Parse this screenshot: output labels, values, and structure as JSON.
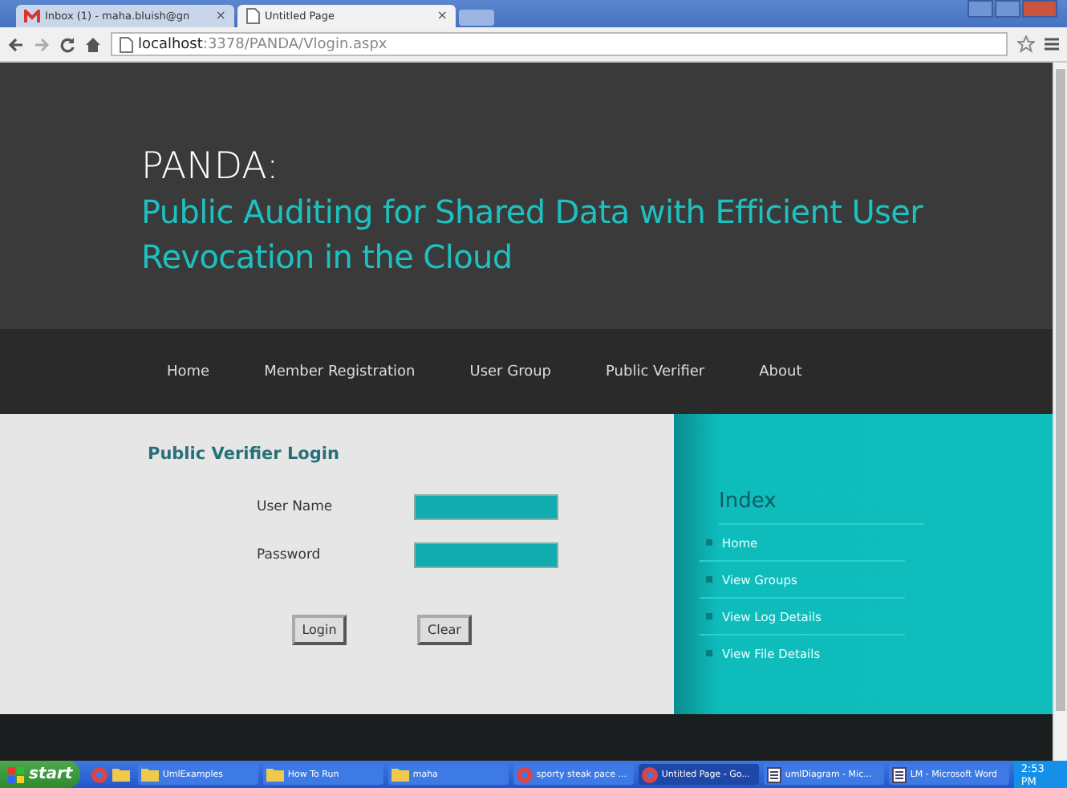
{
  "browser": {
    "tabs": [
      {
        "title": "Inbox (1) - maha.bluish@gn",
        "kind": "mail",
        "close": "×",
        "selected": false
      },
      {
        "title": "Untitled Page",
        "kind": "page",
        "close": "×",
        "selected": true
      }
    ],
    "address": {
      "host": "localhost",
      "rest": ":3378/PANDA/Vlogin.aspx"
    }
  },
  "header": {
    "logo": "PANDA:",
    "subtitle": "Public Auditing for Shared Data with Efficient User Revocation in the Cloud"
  },
  "nav": [
    "Home",
    "Member Registration",
    "User Group",
    "Public Verifier",
    "About"
  ],
  "login": {
    "title": "Public Verifier Login",
    "fields": [
      {
        "label": "User Name"
      },
      {
        "label": "Password"
      }
    ],
    "buttons": [
      "Login",
      "Clear"
    ]
  },
  "sidebar": {
    "title": "Index",
    "items": [
      "Home",
      "View Groups",
      "View Log Details",
      "View File Details"
    ]
  },
  "taskbar": {
    "start": "start",
    "items": [
      {
        "label": "UmlExamples",
        "kind": "folder",
        "selected": false
      },
      {
        "label": "How To Run",
        "kind": "folder",
        "selected": false
      },
      {
        "label": "maha",
        "kind": "folder",
        "selected": false
      },
      {
        "label": "sporty steak pace ...",
        "kind": "browser",
        "selected": false
      },
      {
        "label": "Untitled Page - Go...",
        "kind": "browser",
        "selected": true
      },
      {
        "label": "umlDiagram - Mic...",
        "kind": "doc",
        "selected": false
      },
      {
        "label": "LM - Microsoft Word",
        "kind": "doc",
        "selected": false
      }
    ],
    "clock": "2:53 PM"
  }
}
